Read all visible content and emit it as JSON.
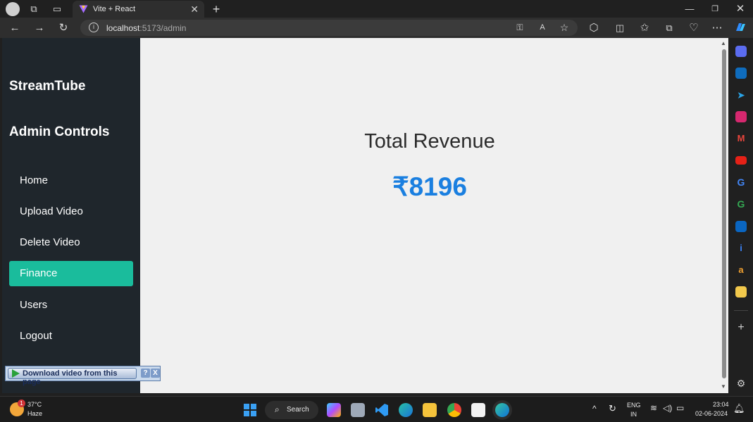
{
  "browser": {
    "tab_title": "Vite + React",
    "url_host": "localhost",
    "url_rest": ":5173/admin"
  },
  "sidebar": {
    "brand": "StreamTube",
    "section_title": "Admin Controls",
    "items": [
      {
        "label": "Home"
      },
      {
        "label": "Upload Video"
      },
      {
        "label": "Delete Video"
      },
      {
        "label": "Finance",
        "active": true
      },
      {
        "label": "Users"
      },
      {
        "label": "Logout"
      }
    ]
  },
  "main": {
    "title": "Total Revenue",
    "amount": "₹8196"
  },
  "extension": {
    "download_label": "Download video from this page",
    "help": "?",
    "close": "X"
  },
  "taskbar": {
    "weather_temp": "37°C",
    "weather_desc": "Haze",
    "weather_badge": "1",
    "search_label": "Search",
    "lang1": "ENG",
    "lang2": "IN",
    "time": "23:04",
    "date": "02-06-2024"
  },
  "colors": {
    "sidebar_bg": "#1f262c",
    "active_item": "#1abc9c",
    "amount_blue": "#1a7fe0"
  }
}
